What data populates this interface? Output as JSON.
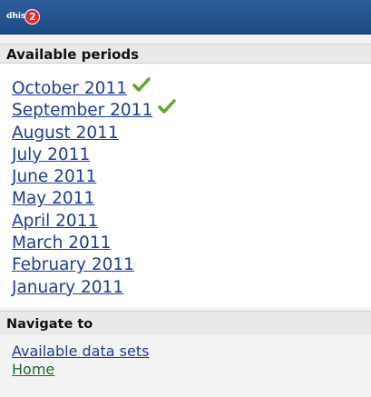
{
  "header": {
    "logo_text": "dhis",
    "logo_badge": "2"
  },
  "periods_section": {
    "title": "Available periods",
    "items": [
      {
        "label": "October 2011",
        "checked": true
      },
      {
        "label": "September 2011",
        "checked": true
      },
      {
        "label": "August 2011",
        "checked": false
      },
      {
        "label": "July 2011",
        "checked": false
      },
      {
        "label": "June 2011",
        "checked": false
      },
      {
        "label": "May 2011",
        "checked": false
      },
      {
        "label": "April 2011",
        "checked": false
      },
      {
        "label": "March 2011",
        "checked": false
      },
      {
        "label": "February 2011",
        "checked": false
      },
      {
        "label": "January 2011",
        "checked": false
      }
    ]
  },
  "navigate_section": {
    "title": "Navigate to",
    "links": [
      {
        "label": "Available data sets"
      },
      {
        "label": "Home"
      }
    ]
  },
  "colors": {
    "topbar": "#1d4a82",
    "link": "#1f3c96",
    "home_link": "#1d6b2a",
    "check": "#5aaa2a",
    "badge": "#e02a2a"
  }
}
